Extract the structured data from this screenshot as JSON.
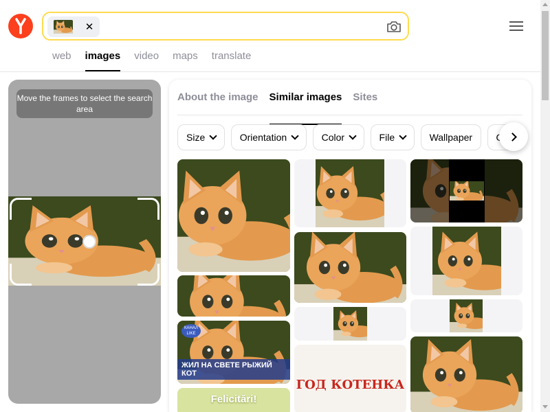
{
  "header": {
    "logo_letter": "Я",
    "search": {
      "query": "",
      "close_glyph": "✕"
    },
    "tabs": [
      {
        "label": "web",
        "active": false
      },
      {
        "label": "images",
        "active": true
      },
      {
        "label": "video",
        "active": false
      },
      {
        "label": "maps",
        "active": false
      },
      {
        "label": "translate",
        "active": false
      }
    ]
  },
  "crop_panel": {
    "hint": "Move the frames to select the search area"
  },
  "results": {
    "tabs": [
      {
        "label": "About the image",
        "active": false
      },
      {
        "label": "Similar images",
        "active": true
      },
      {
        "label": "Sites",
        "active": false
      }
    ],
    "filters": [
      {
        "label": "Size",
        "dropdown": true
      },
      {
        "label": "Orientation",
        "dropdown": true
      },
      {
        "label": "Color",
        "dropdown": true
      },
      {
        "label": "File",
        "dropdown": true
      },
      {
        "label": "Wallpaper",
        "dropdown": false
      },
      {
        "label": "Or",
        "dropdown": false
      }
    ],
    "tile_texts": {
      "caption": "ЖИЛ НА СВЕТЕ РЫЖИЙ КОТ",
      "badge": "КАНАЛ LIKE",
      "felicitari": "Felicitări!",
      "god": "ГОД КОТЕНКА"
    }
  },
  "colors": {
    "brand": "#fc3f1d",
    "search_border": "#ffdb4d",
    "panel_gray": "#a8a8a8"
  },
  "icons": [
    "yandex-logo",
    "close-icon",
    "camera-icon",
    "hamburger-menu-icon",
    "chevron-down-icon",
    "chevron-right-icon"
  ]
}
